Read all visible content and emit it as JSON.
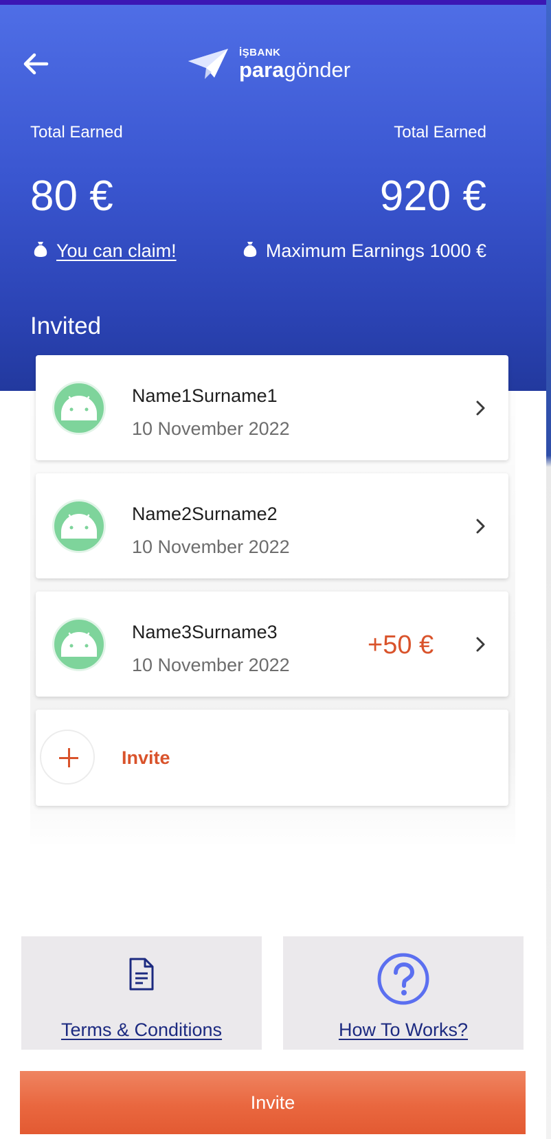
{
  "brand": {
    "logo_top": "İŞBANK",
    "logo_bold": "para",
    "logo_regular": "gönder"
  },
  "header": {
    "left_label": "Total Earned",
    "left_amount": "80 €",
    "left_sub": "You can claim!",
    "right_label": "Total Earned",
    "right_amount": "920 €",
    "right_sub": "Maximum Earnings 1000 €",
    "section_title": "Invited"
  },
  "invitees": [
    {
      "name": "Name1Surname1",
      "date": "10 November 2022",
      "bonus": ""
    },
    {
      "name": "Name2Surname2",
      "date": "10 November 2022",
      "bonus": ""
    },
    {
      "name": "Name3Surname3",
      "date": "10 November 2022",
      "bonus": "+50 €"
    }
  ],
  "invite_row": {
    "label": "Invite"
  },
  "info": {
    "terms_label": "Terms & Conditions",
    "how_label": "How To Works?"
  },
  "cta": {
    "label": "Invite"
  },
  "colors": {
    "header_top": "#4f6ee6",
    "header_bottom": "#22399e",
    "accent": "#d9532b",
    "link": "#1c2a80",
    "help_icon": "#5b6ff0",
    "avatar": "#7ed49b"
  }
}
